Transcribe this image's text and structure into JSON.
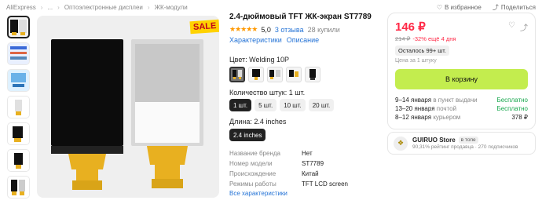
{
  "breadcrumb": [
    "AliExpress",
    "...",
    "Оптоэлектронные дисплеи",
    "ЖК-модули"
  ],
  "top_actions": {
    "favorites": "В избранное",
    "share": "Поделиться"
  },
  "gallery": {
    "sale_label": "SALE"
  },
  "product": {
    "title": "2.4-дюймовый TFT ЖК-экран ST7789",
    "rating": "5,0",
    "reviews": "3 отзыва",
    "bought": "28 купили",
    "tabs": [
      "Характеристики",
      "Описание"
    ],
    "color_label": "Цвет: Welding 10P",
    "quantity_label": "Количество штук: 1 шт.",
    "quantity_options": [
      "1 шт.",
      "5 шт.",
      "10 шт.",
      "20 шт."
    ],
    "length_label": "Длина: 2.4 inches",
    "length_option": "2.4 inches",
    "specs": [
      {
        "key": "Название бренда",
        "value": "Нет"
      },
      {
        "key": "Номер модели",
        "value": "ST7789"
      },
      {
        "key": "Происхождение",
        "value": "Китай"
      },
      {
        "key": "Режимы работы",
        "value": "TFT LCD screen"
      }
    ],
    "more_specs": "Все характеристики"
  },
  "buy": {
    "price": "146 ₽",
    "old_price": "214 ₽",
    "discount": "-32% ещё 4 дня",
    "stock": "Осталось 99+ шт.",
    "per_unit": "Цена за 1 штуку",
    "cart_button": "В корзину",
    "delivery": [
      {
        "date": "9–14 января",
        "method": "в пункт выдачи",
        "cost": "Бесплатно"
      },
      {
        "date": "13–20 января",
        "method": "почтой",
        "cost": "Бесплатно"
      },
      {
        "date": "8–12 января",
        "method": "курьером",
        "cost": "378 ₽"
      }
    ]
  },
  "store": {
    "name": "GUIRUO Store",
    "badge": "в топе",
    "subtitle": "90,31% рейтинг продавца · 270 подписчиков"
  },
  "colors": {
    "accent": "#c3ed4e",
    "price": "#ff2a47",
    "link": "#2473d6",
    "free": "#1aa84f"
  }
}
